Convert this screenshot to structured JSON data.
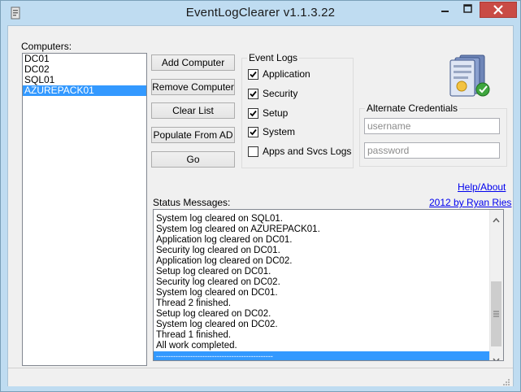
{
  "window": {
    "title": "EventLogClearer v1.1.3.22"
  },
  "computers": {
    "label": "Computers:",
    "items": [
      {
        "name": "DC01",
        "selected": false
      },
      {
        "name": "DC02",
        "selected": false
      },
      {
        "name": "SQL01",
        "selected": false
      },
      {
        "name": "AZUREPACK01",
        "selected": true
      }
    ]
  },
  "buttons": {
    "add_computer": "Add Computer",
    "remove_computer": "Remove Computer",
    "clear_list": "Clear List",
    "populate_from_ad": "Populate From AD",
    "go": "Go"
  },
  "event_logs": {
    "title": "Event Logs",
    "items": [
      {
        "label": "Application",
        "checked": true
      },
      {
        "label": "Security",
        "checked": true
      },
      {
        "label": "Setup",
        "checked": true
      },
      {
        "label": "System",
        "checked": true
      },
      {
        "label": "Apps and Svcs Logs",
        "checked": false
      }
    ]
  },
  "credentials": {
    "title": "Alternate Credentials",
    "username_placeholder": "username",
    "password_placeholder": "password"
  },
  "links": {
    "help": "Help/About",
    "author": "2012 by Ryan Ries"
  },
  "status": {
    "label": "Status Messages:",
    "messages": [
      "System log cleared on SQL01.",
      "System log cleared on AZUREPACK01.",
      "Application log cleared on DC01.",
      "Security log cleared on DC01.",
      "Application log cleared on DC02.",
      "Setup log cleared on DC01.",
      "Security log cleared on DC02.",
      "System log cleared on DC01.",
      "Thread 2 finished.",
      "Setup log cleared on DC02.",
      "System log cleared on DC02.",
      "Thread 1 finished.",
      "All work completed.",
      "------------------------------------------------"
    ],
    "selected_index": 13
  },
  "colors": {
    "titlebar": "#bfdcf1",
    "selection": "#3399ff",
    "close_button": "#c94b45",
    "link": "#0000ee"
  }
}
